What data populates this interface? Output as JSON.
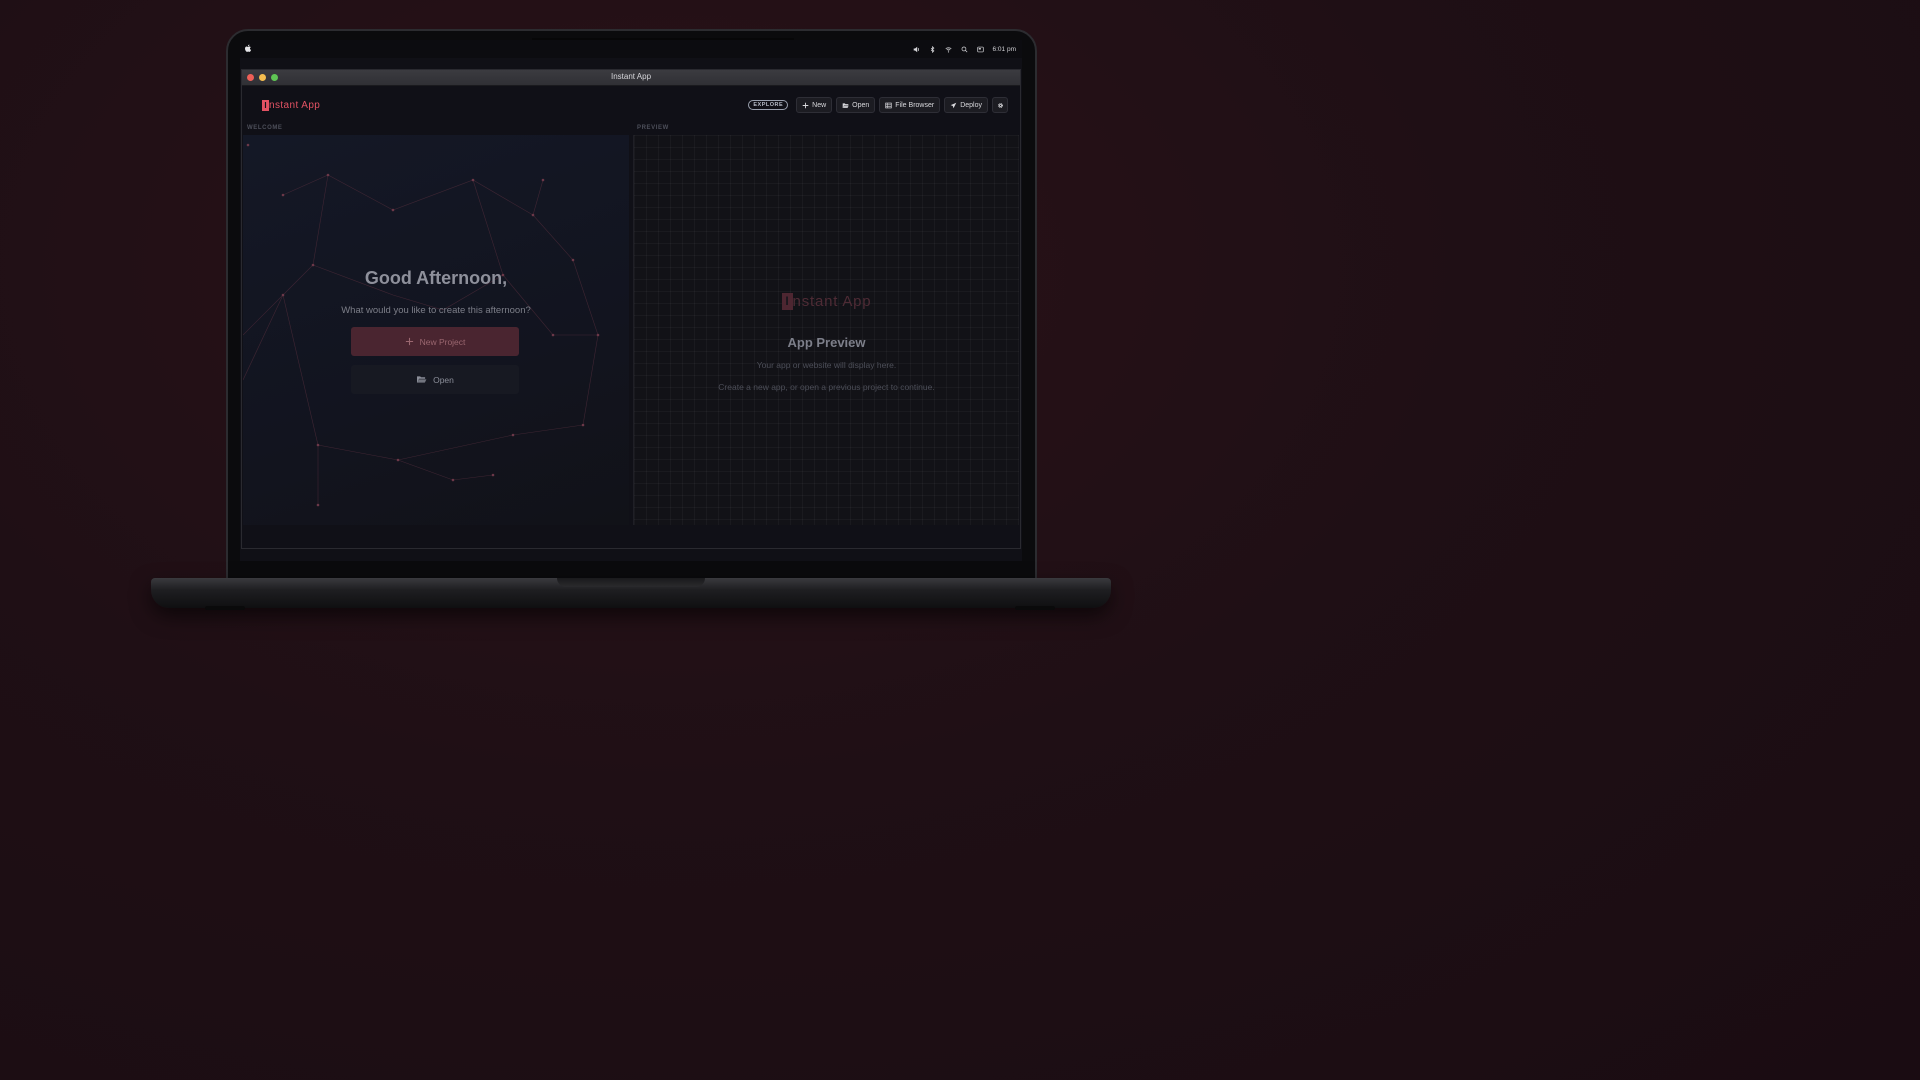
{
  "colors": {
    "background": "#1f0f15",
    "accent": "#e25263",
    "panel": "#12141f",
    "button_primary": "#4a2530"
  },
  "menubar": {
    "time": "6:01 pm",
    "icons": [
      "apple-icon",
      "volume-icon",
      "bluetooth-icon",
      "wifi-icon",
      "search-icon",
      "control-center-icon"
    ]
  },
  "window": {
    "title": "Instant App"
  },
  "header": {
    "brand_mark": "I",
    "brand_text": "nstant App",
    "explore_badge": "EXPLORE",
    "toolbar": {
      "new_label": "New",
      "open_label": "Open",
      "file_browser_label": "File Browser",
      "deploy_label": "Deploy"
    }
  },
  "welcome": {
    "section_label": "WELCOME",
    "greeting": "Good Afternoon,",
    "prompt": "What would you like to create this afternoon?",
    "new_project_label": "New Project",
    "open_label": "Open"
  },
  "preview": {
    "section_label": "PREVIEW",
    "brand_mark": "I",
    "brand_text": "nstant App",
    "title": "App Preview",
    "line1": "Your app or website will display here.",
    "line2": "Create a new app, or open a previous project to continue."
  }
}
